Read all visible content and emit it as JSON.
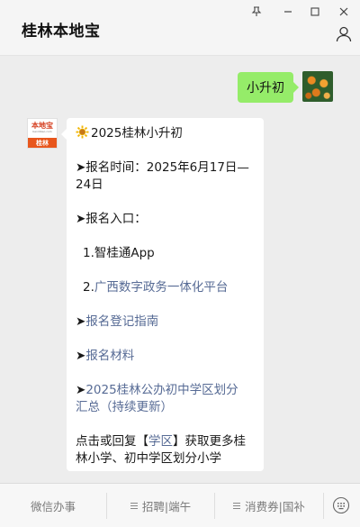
{
  "window": {
    "title": "桂林本地宝",
    "controls": [
      "pin-icon",
      "minimize-icon",
      "maximize-icon",
      "close-icon"
    ]
  },
  "chat": {
    "outgoing_message": "小升初",
    "incoming": {
      "lines": {
        "heading": "2025桂林小升初",
        "time": "➤报名时间：2025年6月17日—24日",
        "entry_title": "➤报名入口：",
        "entry_1": "1.智桂通App",
        "entry_2_num": "2.",
        "entry_2_link": "广西数字政务一体化平台",
        "arrow": "➤",
        "guide_link": "报名登记指南",
        "materials_link": "报名材料",
        "district_link_a": "2025桂林公办初中学区划分",
        "district_link_b": "汇总（持续更新）",
        "footer_a": "点击或回复【",
        "footer_kw": "学区",
        "footer_b": "】获取更多桂林小学、初中学区划分小学"
      }
    }
  },
  "logo": {
    "top": "本地宝",
    "sub": "bendibao.com",
    "band": "桂林"
  },
  "bottom_menu": {
    "items": [
      "微信办事",
      "招聘|端午",
      "消费券|国补"
    ]
  },
  "colors": {
    "outgoing_bubble": "#95ec69",
    "link": "#576b95",
    "brand_orange": "#e8561c"
  }
}
